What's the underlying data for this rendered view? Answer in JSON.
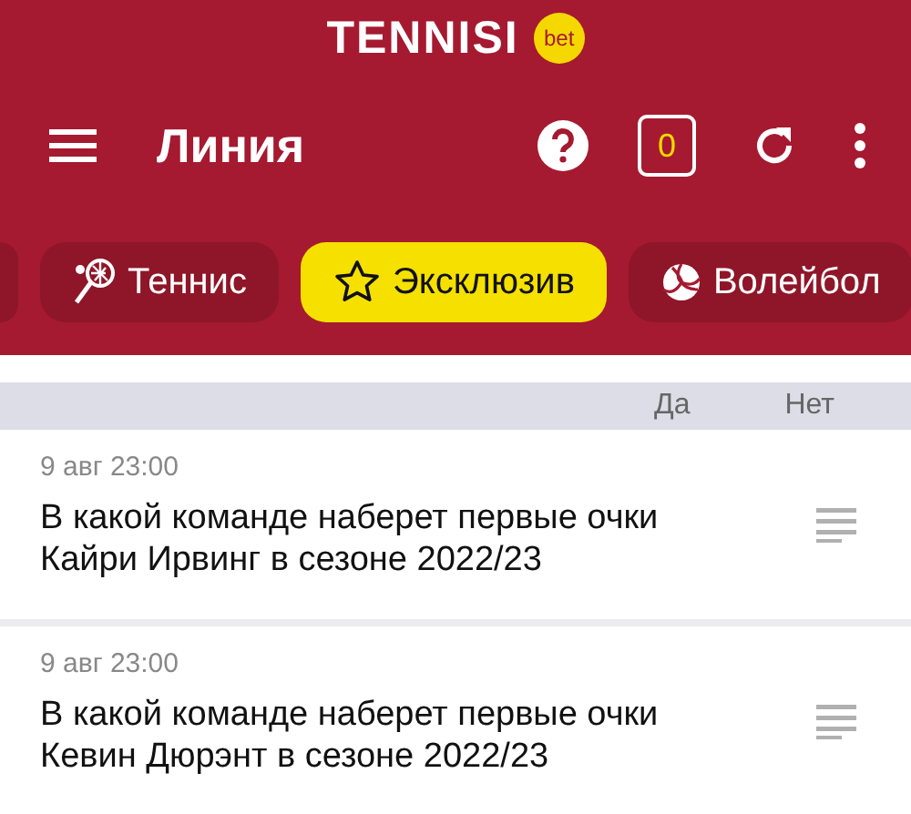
{
  "logo": {
    "name": "TENNISI",
    "badge": "bet"
  },
  "toolbar": {
    "title": "Линия",
    "coupon_count": "0"
  },
  "sports": [
    {
      "label": "Теннис",
      "kind": "tennis",
      "selected": false
    },
    {
      "label": "Эксклюзив",
      "kind": "star",
      "selected": true
    },
    {
      "label": "Волейбол",
      "kind": "volleyball",
      "selected": false
    }
  ],
  "columns": [
    "Да",
    "Нет"
  ],
  "events": [
    {
      "time": "9 авг 23:00",
      "title": "В какой команде наберет первые очки Кайри Ирвинг в сезоне 2022/23"
    },
    {
      "time": "9 авг 23:00",
      "title": "В какой команде наберет первые очки Кевин Дюрэнт в сезоне 2022/23"
    }
  ]
}
